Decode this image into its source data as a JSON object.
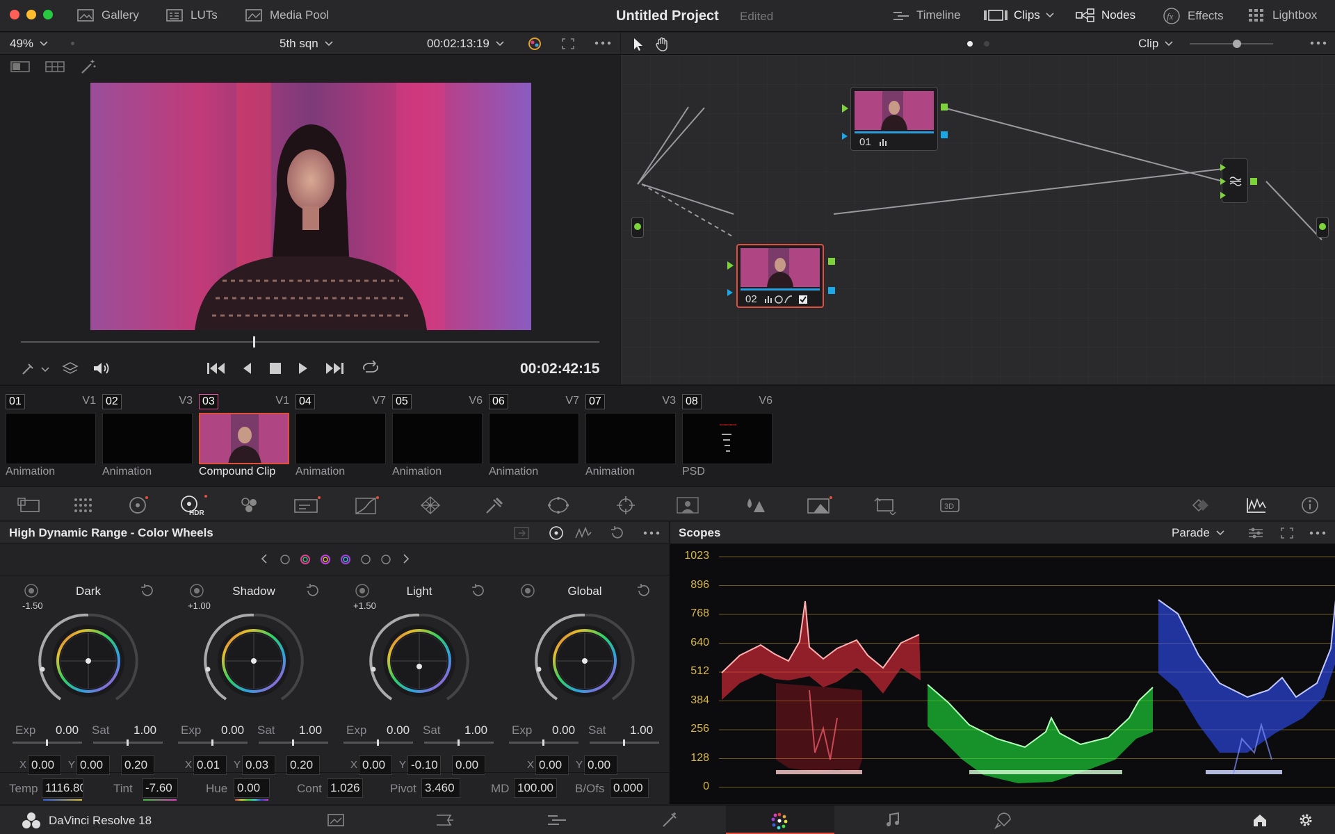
{
  "topbar": {
    "gallery": "Gallery",
    "luts": "LUTs",
    "media_pool": "Media Pool",
    "project_title": "Untitled Project",
    "edited": "Edited",
    "timeline": "Timeline",
    "clips": "Clips",
    "nodes": "Nodes",
    "effects": "Effects",
    "lightbox": "Lightbox"
  },
  "viewer": {
    "zoom": "49%",
    "clip_name": "5th sqn",
    "timecode_top": "00:02:13:19",
    "timecode": "00:02:42:15"
  },
  "nodes": {
    "mode": "Clip",
    "node1_label": "01",
    "node2_label": "02"
  },
  "clips": [
    {
      "num": "01",
      "track": "V1",
      "label": "Animation"
    },
    {
      "num": "02",
      "track": "V3",
      "label": "Animation"
    },
    {
      "num": "03",
      "track": "V1",
      "label": "Compound Clip"
    },
    {
      "num": "04",
      "track": "V7",
      "label": "Animation"
    },
    {
      "num": "05",
      "track": "V6",
      "label": "Animation"
    },
    {
      "num": "06",
      "track": "V7",
      "label": "Animation"
    },
    {
      "num": "07",
      "track": "V3",
      "label": "Animation"
    },
    {
      "num": "08",
      "track": "V6",
      "label": "PSD"
    }
  ],
  "wheels": {
    "title": "High Dynamic Range - Color Wheels",
    "items": [
      {
        "name": "Dark",
        "range": "-1.50",
        "exp": "0.00",
        "sat": "1.00",
        "x": "0.00",
        "y": "0.00",
        "z": "0.20"
      },
      {
        "name": "Shadow",
        "range": "+1.00",
        "exp": "0.00",
        "sat": "1.00",
        "x": "0.01",
        "y": "0.03",
        "z": "0.20"
      },
      {
        "name": "Light",
        "range": "+1.50",
        "exp": "0.00",
        "sat": "1.00",
        "x": "0.00",
        "y": "-0.10",
        "z": "0.00"
      },
      {
        "name": "Global",
        "range": "",
        "exp": "0.00",
        "sat": "1.00",
        "x": "0.00",
        "y": "0.00",
        "z": ""
      }
    ],
    "labels": {
      "exp": "Exp",
      "sat": "Sat",
      "x": "X",
      "y": "Y"
    },
    "bottom": {
      "temp_label": "Temp",
      "temp": "1116.80",
      "tint_label": "Tint",
      "tint": "-7.60",
      "hue_label": "Hue",
      "hue": "0.00",
      "cont_label": "Cont",
      "cont": "1.026",
      "pivot_label": "Pivot",
      "pivot": "3.460",
      "md_label": "MD",
      "md": "100.00",
      "bofs_label": "B/Ofs",
      "bofs": "0.000"
    }
  },
  "scopes": {
    "title": "Scopes",
    "mode": "Parade",
    "ticks": [
      "1023",
      "896",
      "768",
      "640",
      "512",
      "384",
      "256",
      "128",
      "0"
    ]
  },
  "footer": {
    "app_name": "DaVinci Resolve 18"
  },
  "colors": {
    "accent_red": "#e0503e",
    "scope_tick": "#d8b84a",
    "node_green": "#7cd33a",
    "node_blue": "#1aa8e8"
  }
}
